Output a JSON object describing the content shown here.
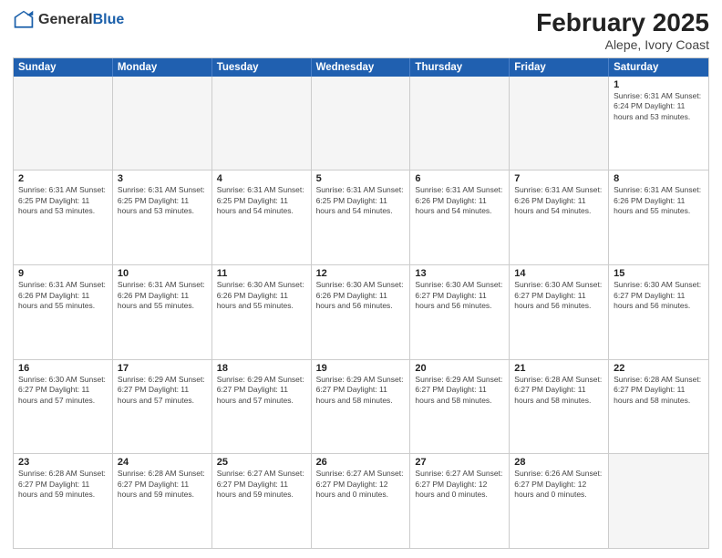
{
  "header": {
    "logo_general": "General",
    "logo_blue": "Blue",
    "main_title": "February 2025",
    "sub_title": "Alepe, Ivory Coast"
  },
  "calendar": {
    "day_headers": [
      "Sunday",
      "Monday",
      "Tuesday",
      "Wednesday",
      "Thursday",
      "Friday",
      "Saturday"
    ],
    "weeks": [
      [
        {
          "day": "",
          "info": ""
        },
        {
          "day": "",
          "info": ""
        },
        {
          "day": "",
          "info": ""
        },
        {
          "day": "",
          "info": ""
        },
        {
          "day": "",
          "info": ""
        },
        {
          "day": "",
          "info": ""
        },
        {
          "day": "1",
          "info": "Sunrise: 6:31 AM\nSunset: 6:24 PM\nDaylight: 11 hours and 53 minutes."
        }
      ],
      [
        {
          "day": "2",
          "info": "Sunrise: 6:31 AM\nSunset: 6:25 PM\nDaylight: 11 hours and 53 minutes."
        },
        {
          "day": "3",
          "info": "Sunrise: 6:31 AM\nSunset: 6:25 PM\nDaylight: 11 hours and 53 minutes."
        },
        {
          "day": "4",
          "info": "Sunrise: 6:31 AM\nSunset: 6:25 PM\nDaylight: 11 hours and 54 minutes."
        },
        {
          "day": "5",
          "info": "Sunrise: 6:31 AM\nSunset: 6:25 PM\nDaylight: 11 hours and 54 minutes."
        },
        {
          "day": "6",
          "info": "Sunrise: 6:31 AM\nSunset: 6:26 PM\nDaylight: 11 hours and 54 minutes."
        },
        {
          "day": "7",
          "info": "Sunrise: 6:31 AM\nSunset: 6:26 PM\nDaylight: 11 hours and 54 minutes."
        },
        {
          "day": "8",
          "info": "Sunrise: 6:31 AM\nSunset: 6:26 PM\nDaylight: 11 hours and 55 minutes."
        }
      ],
      [
        {
          "day": "9",
          "info": "Sunrise: 6:31 AM\nSunset: 6:26 PM\nDaylight: 11 hours and 55 minutes."
        },
        {
          "day": "10",
          "info": "Sunrise: 6:31 AM\nSunset: 6:26 PM\nDaylight: 11 hours and 55 minutes."
        },
        {
          "day": "11",
          "info": "Sunrise: 6:30 AM\nSunset: 6:26 PM\nDaylight: 11 hours and 55 minutes."
        },
        {
          "day": "12",
          "info": "Sunrise: 6:30 AM\nSunset: 6:26 PM\nDaylight: 11 hours and 56 minutes."
        },
        {
          "day": "13",
          "info": "Sunrise: 6:30 AM\nSunset: 6:27 PM\nDaylight: 11 hours and 56 minutes."
        },
        {
          "day": "14",
          "info": "Sunrise: 6:30 AM\nSunset: 6:27 PM\nDaylight: 11 hours and 56 minutes."
        },
        {
          "day": "15",
          "info": "Sunrise: 6:30 AM\nSunset: 6:27 PM\nDaylight: 11 hours and 56 minutes."
        }
      ],
      [
        {
          "day": "16",
          "info": "Sunrise: 6:30 AM\nSunset: 6:27 PM\nDaylight: 11 hours and 57 minutes."
        },
        {
          "day": "17",
          "info": "Sunrise: 6:29 AM\nSunset: 6:27 PM\nDaylight: 11 hours and 57 minutes."
        },
        {
          "day": "18",
          "info": "Sunrise: 6:29 AM\nSunset: 6:27 PM\nDaylight: 11 hours and 57 minutes."
        },
        {
          "day": "19",
          "info": "Sunrise: 6:29 AM\nSunset: 6:27 PM\nDaylight: 11 hours and 58 minutes."
        },
        {
          "day": "20",
          "info": "Sunrise: 6:29 AM\nSunset: 6:27 PM\nDaylight: 11 hours and 58 minutes."
        },
        {
          "day": "21",
          "info": "Sunrise: 6:28 AM\nSunset: 6:27 PM\nDaylight: 11 hours and 58 minutes."
        },
        {
          "day": "22",
          "info": "Sunrise: 6:28 AM\nSunset: 6:27 PM\nDaylight: 11 hours and 58 minutes."
        }
      ],
      [
        {
          "day": "23",
          "info": "Sunrise: 6:28 AM\nSunset: 6:27 PM\nDaylight: 11 hours and 59 minutes."
        },
        {
          "day": "24",
          "info": "Sunrise: 6:28 AM\nSunset: 6:27 PM\nDaylight: 11 hours and 59 minutes."
        },
        {
          "day": "25",
          "info": "Sunrise: 6:27 AM\nSunset: 6:27 PM\nDaylight: 11 hours and 59 minutes."
        },
        {
          "day": "26",
          "info": "Sunrise: 6:27 AM\nSunset: 6:27 PM\nDaylight: 12 hours and 0 minutes."
        },
        {
          "day": "27",
          "info": "Sunrise: 6:27 AM\nSunset: 6:27 PM\nDaylight: 12 hours and 0 minutes."
        },
        {
          "day": "28",
          "info": "Sunrise: 6:26 AM\nSunset: 6:27 PM\nDaylight: 12 hours and 0 minutes."
        },
        {
          "day": "",
          "info": ""
        }
      ]
    ]
  }
}
